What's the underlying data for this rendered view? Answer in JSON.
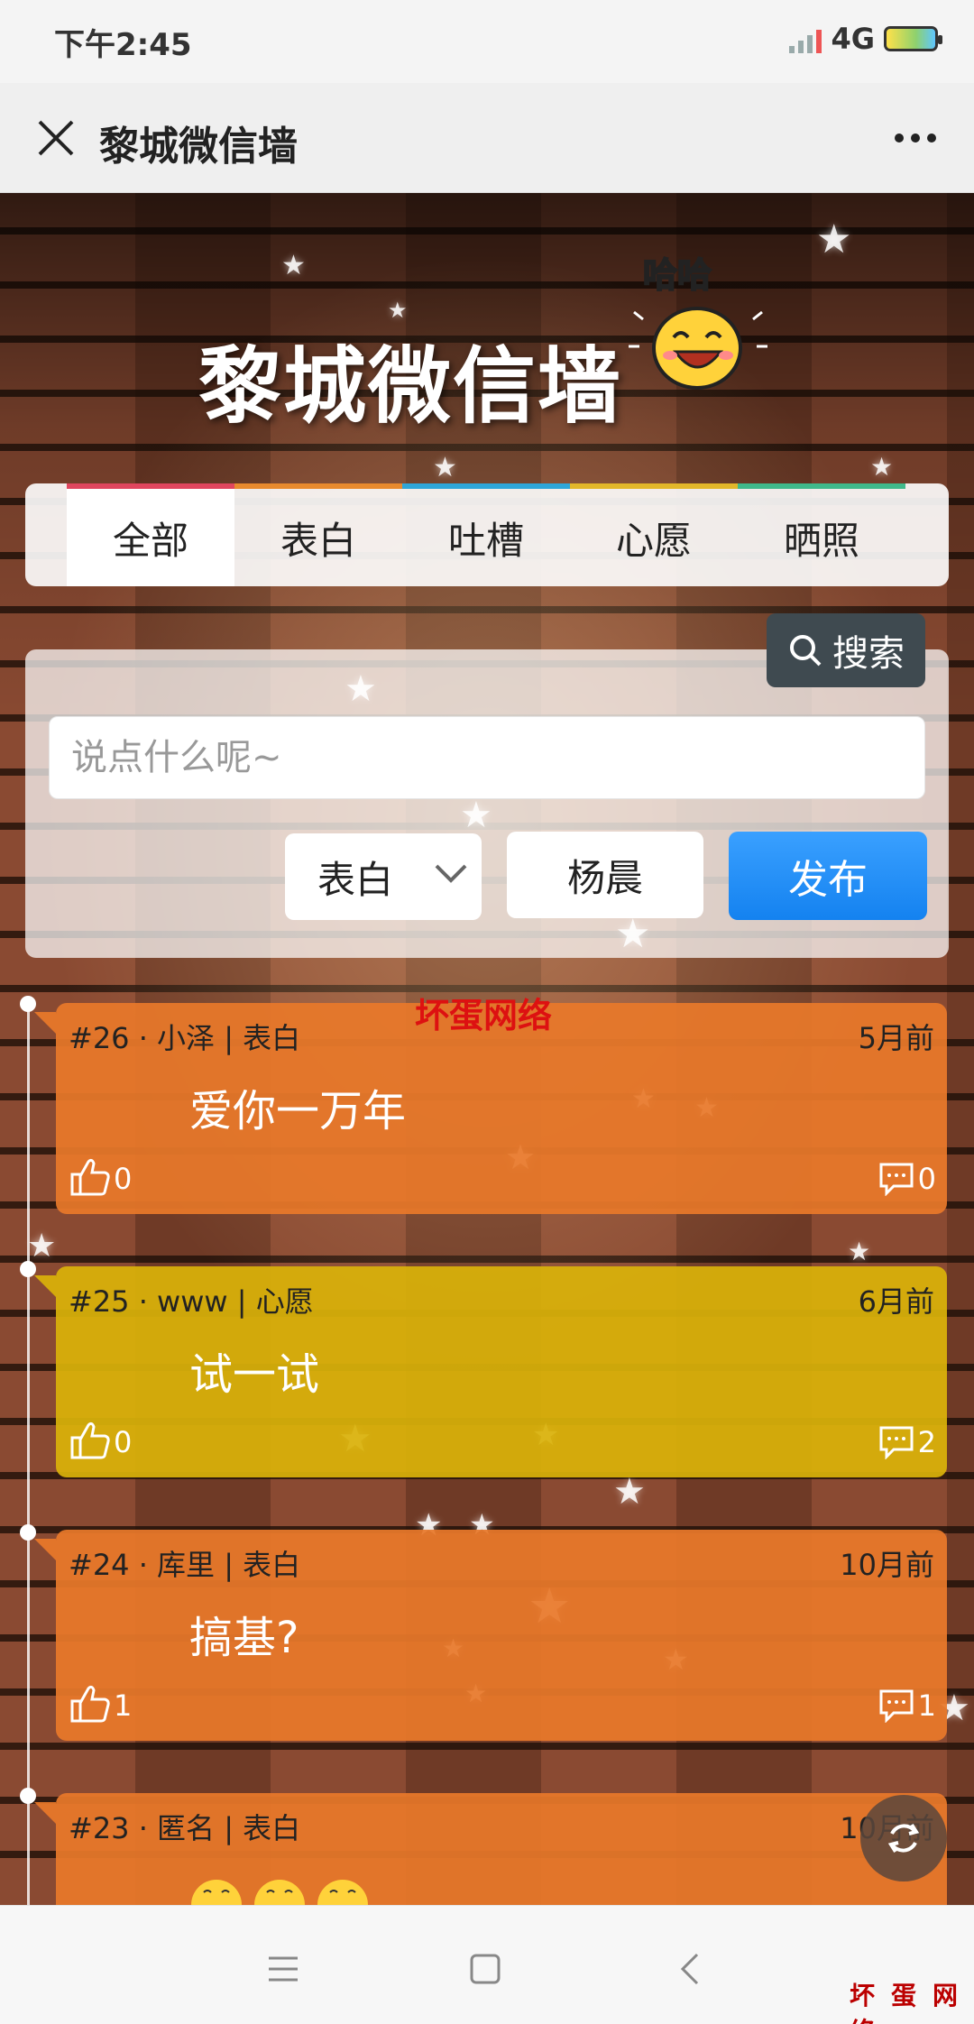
{
  "status_bar": {
    "time": "下午2:45",
    "network": "4G"
  },
  "titlebar": {
    "title": "黎城微信墙"
  },
  "banner": {
    "title": "黎城微信墙",
    "emoji_text": "哈哈"
  },
  "tabs": [
    {
      "label": "全部",
      "color": "#e0465e"
    },
    {
      "label": "表白",
      "color": "#e88a2e"
    },
    {
      "label": "吐槽",
      "color": "#2ea6d8"
    },
    {
      "label": "心愿",
      "color": "#e2b72a"
    },
    {
      "label": "晒照",
      "color": "#3fb98a"
    }
  ],
  "search": {
    "label": "搜索"
  },
  "form": {
    "placeholder": "说点什么呢~",
    "type_value": "表白",
    "name_value": "杨晨",
    "publish_label": "发布"
  },
  "watermark": "坏蛋网络",
  "watermark_corner": "坏蛋网络",
  "posts": [
    {
      "meta": "#26 · 小泽 | 表白",
      "time": "5月前",
      "text": "爱你一万年",
      "likes": "0",
      "comments": "0",
      "color": "#e8782a"
    },
    {
      "meta": "#25 · www | 心愿",
      "time": "6月前",
      "text": "试一试",
      "likes": "0",
      "comments": "2",
      "color": "#d9b20a"
    },
    {
      "meta": "#24 · 库里 | 表白",
      "time": "10月前",
      "text": "搞基?",
      "likes": "1",
      "comments": "1",
      "color": "#e8782a"
    },
    {
      "meta": "#23 · 匿名 | 表白",
      "time": "10月前",
      "text": "",
      "likes": "",
      "comments": "",
      "color": "#e8782a"
    }
  ]
}
